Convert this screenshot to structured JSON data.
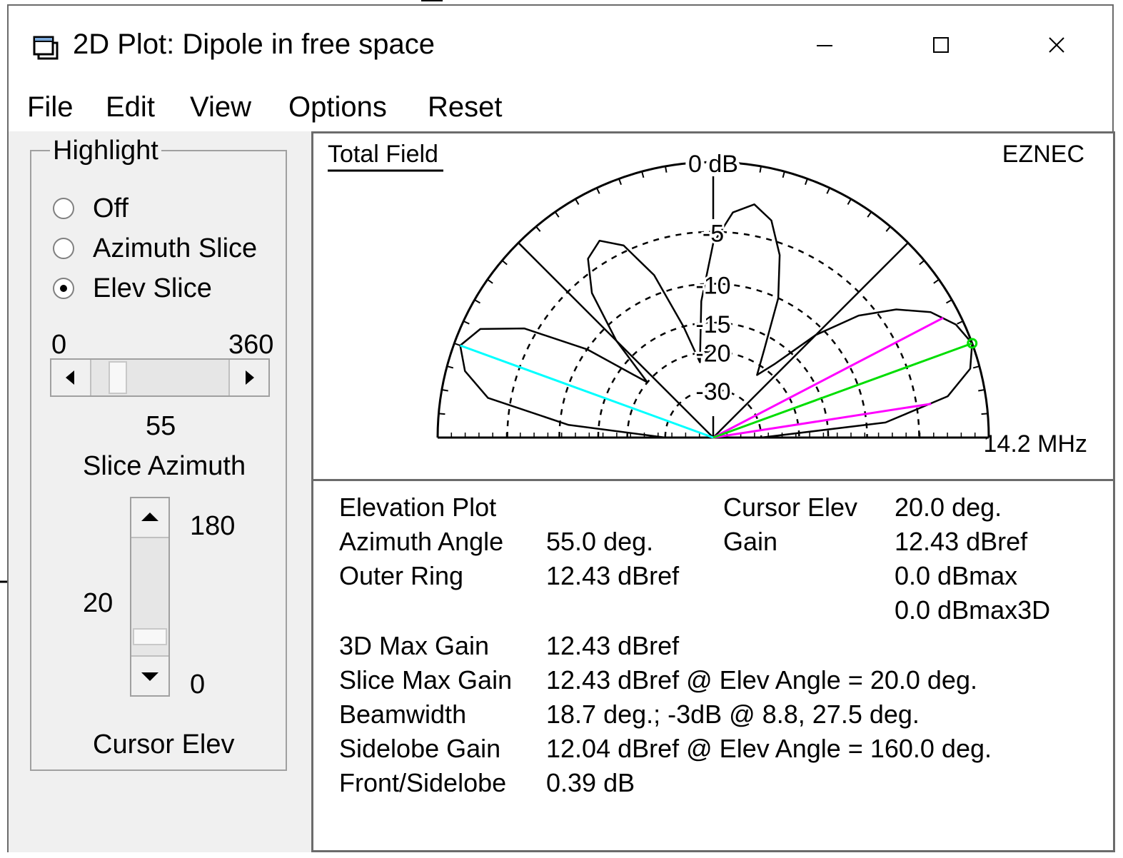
{
  "window": {
    "title": "2D Plot: Dipole in free space"
  },
  "menu": [
    "File",
    "Edit",
    "View",
    "Options",
    "Reset"
  ],
  "highlight": {
    "legend": "Highlight",
    "options": [
      {
        "label": "Off",
        "selected": false
      },
      {
        "label": "Azimuth Slice",
        "selected": false
      },
      {
        "label": "Elev Slice",
        "selected": true
      }
    ]
  },
  "slice_azimuth": {
    "min": "0",
    "max": "360",
    "value": "55",
    "label": "Slice Azimuth"
  },
  "cursor_elev": {
    "max": "180",
    "value": "20",
    "min": "0",
    "label": "Cursor Elev"
  },
  "plot": {
    "tab_label": "Total Field",
    "brand": "EZNEC",
    "frequency": "14.2 MHz",
    "ring_labels": [
      "0 dB",
      "-5",
      "-10",
      "-15",
      "-20",
      "-30"
    ],
    "colors": {
      "cursor": "#00ffff",
      "beamwidth": "#ff00ff",
      "max_gain": "#00dd00"
    }
  },
  "chart_data": {
    "type": "polar",
    "title": "Total Field",
    "ring_values_db": [
      0,
      -5,
      -10,
      -15,
      -20,
      -30
    ],
    "theta_unit": "deg elevation",
    "pattern": {
      "theta": [
        0,
        5,
        10,
        15,
        20,
        25,
        30,
        35,
        40,
        45,
        50,
        55,
        60,
        65,
        70,
        75,
        80,
        85,
        90,
        95,
        100,
        105,
        110,
        115,
        120,
        125,
        130,
        135,
        140,
        145,
        150,
        155,
        160,
        165,
        170,
        175,
        180
      ],
      "gain_db": [
        -30,
        -8,
        -2.5,
        -0.6,
        0,
        -0.5,
        -1.6,
        -3.6,
        -6.4,
        -11,
        -18,
        -22,
        -17,
        -10,
        -6,
        -3.5,
        -2.6,
        -3.4,
        -6,
        -12,
        -22,
        -15,
        -8,
        -4.5,
        -3.3,
        -4,
        -6.5,
        -12,
        -20,
        -10,
        -4,
        -1.2,
        -0.4,
        -1.2,
        -3.2,
        -11,
        -30
      ]
    },
    "cursor_elev_deg": 20,
    "max_gain_elev_deg": 20,
    "beamwidth_edges_deg": [
      8.8,
      27.5
    ],
    "cursor_on_left_deg": 160
  },
  "info": {
    "rows": [
      {
        "label": "Elevation Plot",
        "value": ""
      },
      {
        "label": "Azimuth Angle",
        "value": "55.0 deg."
      },
      {
        "label": "Outer Ring",
        "value": "12.43 dBref"
      },
      {
        "label": "3D Max Gain",
        "value": "12.43 dBref"
      },
      {
        "label": "Slice Max Gain",
        "value": "12.43 dBref @ Elev Angle = 20.0 deg."
      },
      {
        "label": "Beamwidth",
        "value": "18.7 deg.; -3dB @ 8.8, 27.5 deg."
      },
      {
        "label": "Sidelobe Gain",
        "value": "12.04 dBref @ Elev Angle = 160.0 deg."
      },
      {
        "label": "Front/Sidelobe",
        "value": "0.39 dB"
      }
    ],
    "cursor_elev_label": "Cursor Elev",
    "cursor_elev_value": "20.0 deg.",
    "gain_label": "Gain",
    "gain_values": [
      "12.43 dBref",
      "0.0 dBmax",
      "0.0 dBmax3D"
    ]
  }
}
